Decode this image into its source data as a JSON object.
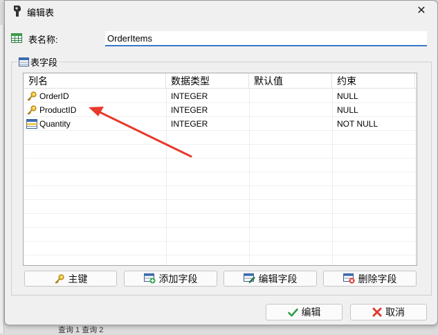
{
  "window": {
    "title": "编辑表"
  },
  "table_name": {
    "label": "表名称:",
    "value": "OrderItems"
  },
  "fields_group": {
    "label": "表字段"
  },
  "grid": {
    "columns": [
      "列名",
      "数据类型",
      "默认值",
      "约束"
    ],
    "rows": [
      {
        "icon": "key-icon",
        "name": "OrderID",
        "type": "INTEGER",
        "default": "",
        "constraint": "NULL"
      },
      {
        "icon": "key-icon",
        "name": "ProductID",
        "type": "INTEGER",
        "default": "",
        "constraint": "NULL"
      },
      {
        "icon": "field-icon",
        "name": "Quantity",
        "type": "INTEGER",
        "default": "",
        "constraint": "NOT NULL"
      }
    ]
  },
  "actions": {
    "primary_key": "主键",
    "add_field": "添加字段",
    "edit_field": "编辑字段",
    "delete_field": "删除字段"
  },
  "footer": {
    "ok": "编辑",
    "cancel": "取消"
  },
  "background": {
    "tabs_text": "查询 1  查询 2"
  },
  "colors": {
    "accent": "#3a78c8",
    "annotation_arrow": "#e8392b",
    "key_gold": "#e0a81c"
  }
}
